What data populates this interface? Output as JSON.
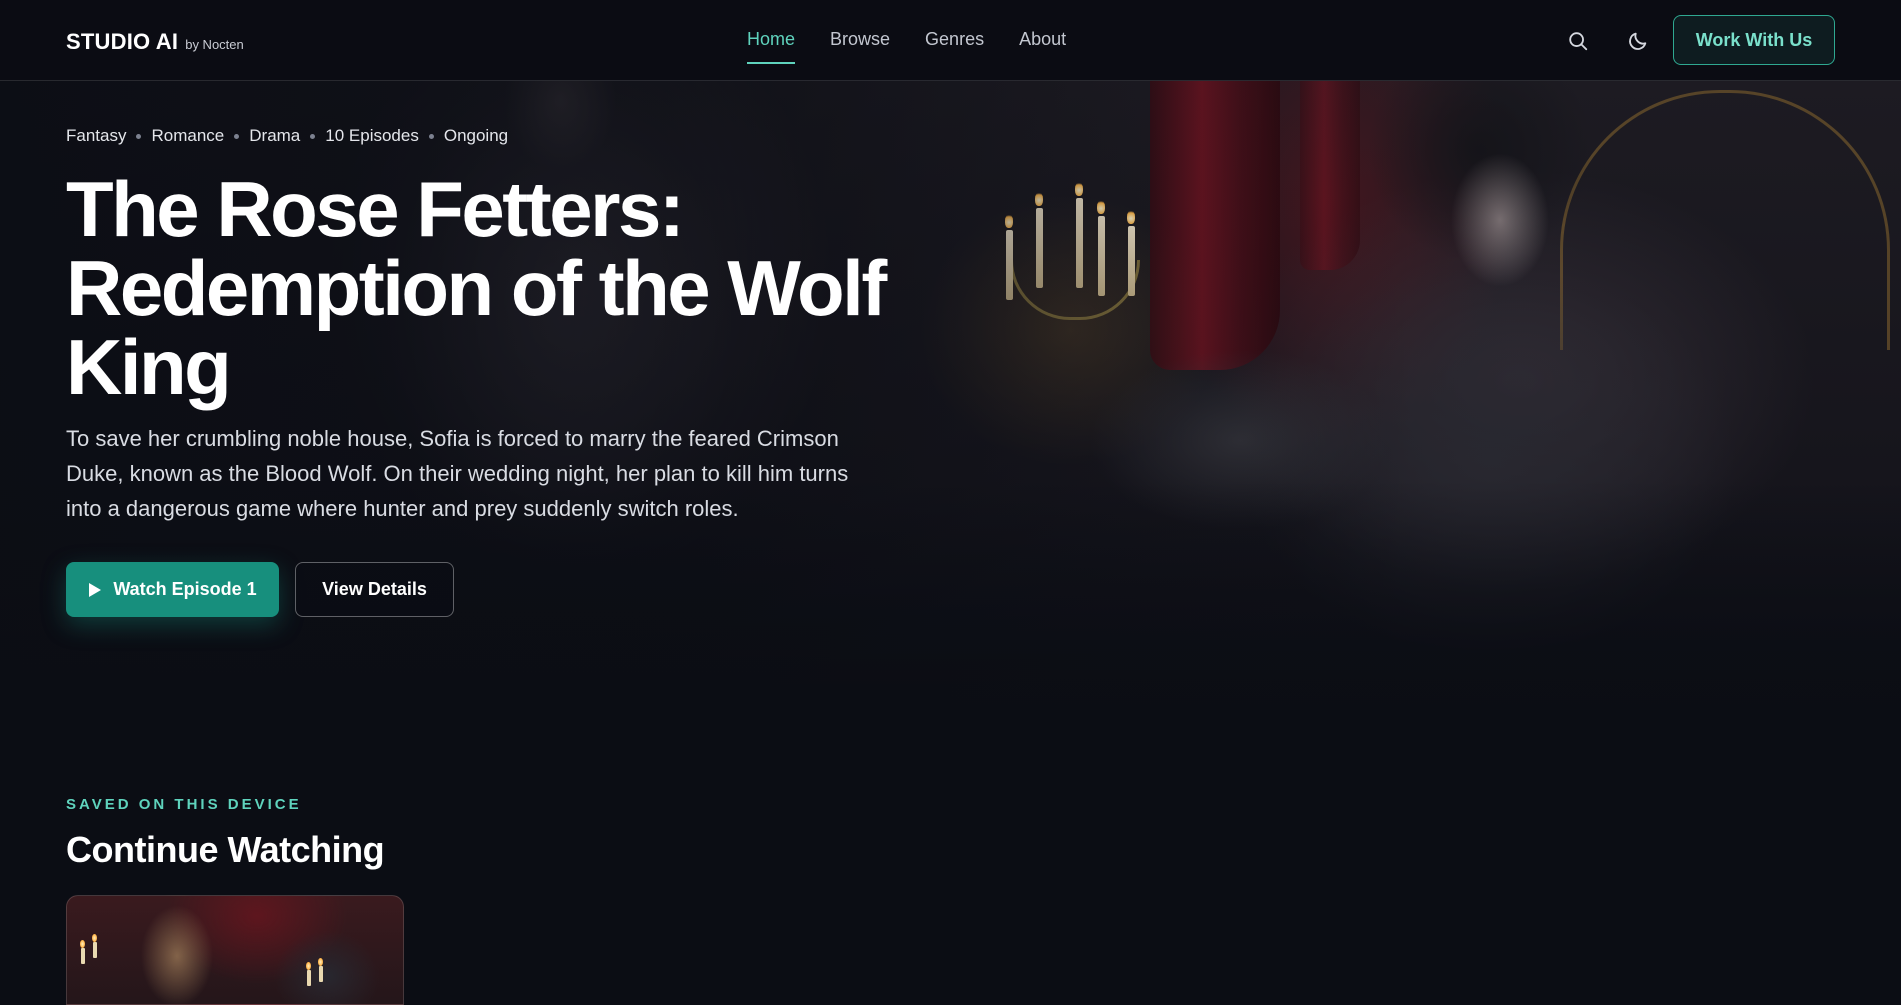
{
  "nav": {
    "logo_main": "STUDIO AI",
    "logo_sub": "by Nocten",
    "links": [
      {
        "label": "Home",
        "active": true
      },
      {
        "label": "Browse",
        "active": false
      },
      {
        "label": "Genres",
        "active": false
      },
      {
        "label": "About",
        "active": false
      }
    ],
    "search_icon": "search-icon",
    "theme_icon": "moon-icon",
    "cta_label": "Work With Us"
  },
  "hero": {
    "meta": [
      "Fantasy",
      "Romance",
      "Drama",
      "10 Episodes",
      "Ongoing"
    ],
    "title": "The Rose Fetters: Redemption of the Wolf King",
    "description": "To save her crumbling noble house, Sofia is forced to marry the feared Crimson Duke, known as the Blood Wolf. On their wedding night, her plan to kill him turns into a dangerous game where hunter and prey suddenly switch roles.",
    "primary_button": "Watch Episode 1",
    "primary_icon": "play-icon",
    "secondary_button": "View Details"
  },
  "continue_watching": {
    "eyebrow": "SAVED ON THIS DEVICE",
    "title": "Continue Watching"
  },
  "colors": {
    "accent": "#5fd3bd",
    "primary_button": "#178f7d",
    "background": "#0b0d14"
  }
}
